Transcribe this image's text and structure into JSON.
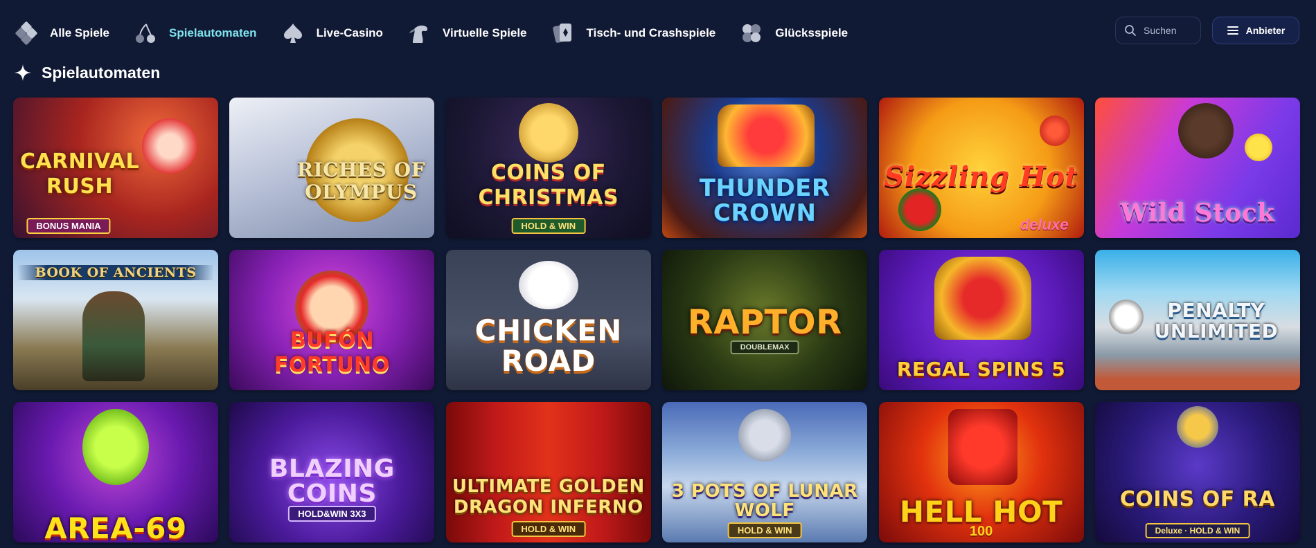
{
  "nav": {
    "items": [
      {
        "label": "Alle Spiele",
        "icon": "cards-grid-icon",
        "active": false
      },
      {
        "label": "Spielautomaten",
        "icon": "cherries-icon",
        "active": true
      },
      {
        "label": "Live-Casino",
        "icon": "spade-icon",
        "active": false
      },
      {
        "label": "Virtuelle Spiele",
        "icon": "horse-icon",
        "active": false
      },
      {
        "label": "Tisch- und Crashspiele",
        "icon": "playing-card-icon",
        "active": false
      },
      {
        "label": "Glücksspiele",
        "icon": "clover-icon",
        "active": false
      }
    ],
    "accent_color": "#7fe3ee"
  },
  "search": {
    "placeholder": "Suchen"
  },
  "provider_button": {
    "label": "Anbieter"
  },
  "section": {
    "title": "Spielautomaten"
  },
  "games": [
    {
      "title": "Carnival Rush",
      "sub": "BONUS MANIA"
    },
    {
      "title": "Riches of Olympus",
      "sub": ""
    },
    {
      "title": "Coins of Christmas",
      "sub": "HOLD & WIN"
    },
    {
      "title": "Thunder Crown",
      "sub": ""
    },
    {
      "title": "Sizzling Hot",
      "sub": "deluxe"
    },
    {
      "title": "Wild Stock",
      "sub": ""
    },
    {
      "title": "Book of Ancients",
      "sub": ""
    },
    {
      "title": "Bufón Fortuno",
      "sub": ""
    },
    {
      "title": "Chicken Road",
      "sub": ""
    },
    {
      "title": "Raptor",
      "sub": "DOUBLEMAX"
    },
    {
      "title": "Regal Spins 5",
      "sub": ""
    },
    {
      "title": "Penalty Unlimited",
      "sub": ""
    },
    {
      "title": "Area-69",
      "sub": ""
    },
    {
      "title": "Blazing Coins",
      "sub": "HOLD&WIN 3X3"
    },
    {
      "title": "Ultimate Golden Dragon Inferno",
      "sub": "HOLD & WIN"
    },
    {
      "title": "3 Pots of Lunar Wolf",
      "sub": "HOLD & WIN"
    },
    {
      "title": "Hell Hot",
      "sub": "100"
    },
    {
      "title": "Coins of Ra",
      "sub": "Deluxe · HOLD & WIN"
    }
  ]
}
